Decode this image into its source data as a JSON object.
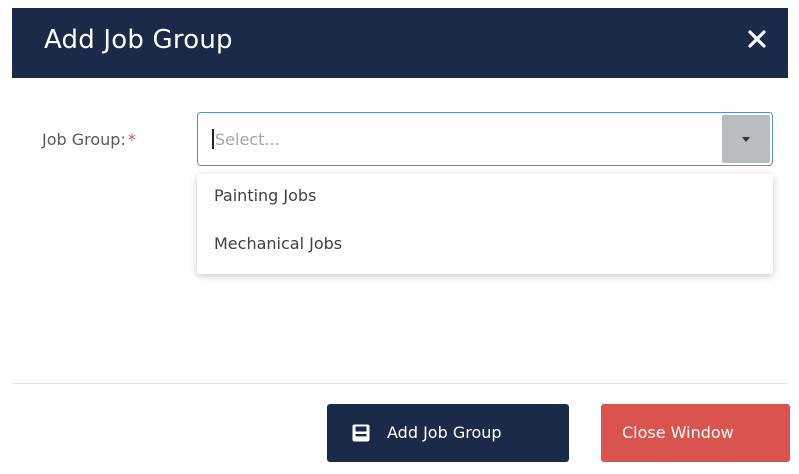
{
  "modal": {
    "title": "Add Job Group"
  },
  "form": {
    "job_group_label": "Job Group:",
    "required_marker": "*",
    "select_placeholder": "Select...",
    "options": [
      "Painting Jobs",
      "Mechanical Jobs"
    ]
  },
  "footer": {
    "add_label": "Add Job Group",
    "close_label": "Close Window"
  },
  "colors": {
    "header_bg": "#1c2a4a",
    "primary_button": "#1c2a4a",
    "danger_button": "#d9534f",
    "focus_border": "#5b8ed6"
  },
  "icons": {
    "close": "close-icon",
    "dropdown": "chevron-down-icon",
    "save": "save-icon"
  }
}
